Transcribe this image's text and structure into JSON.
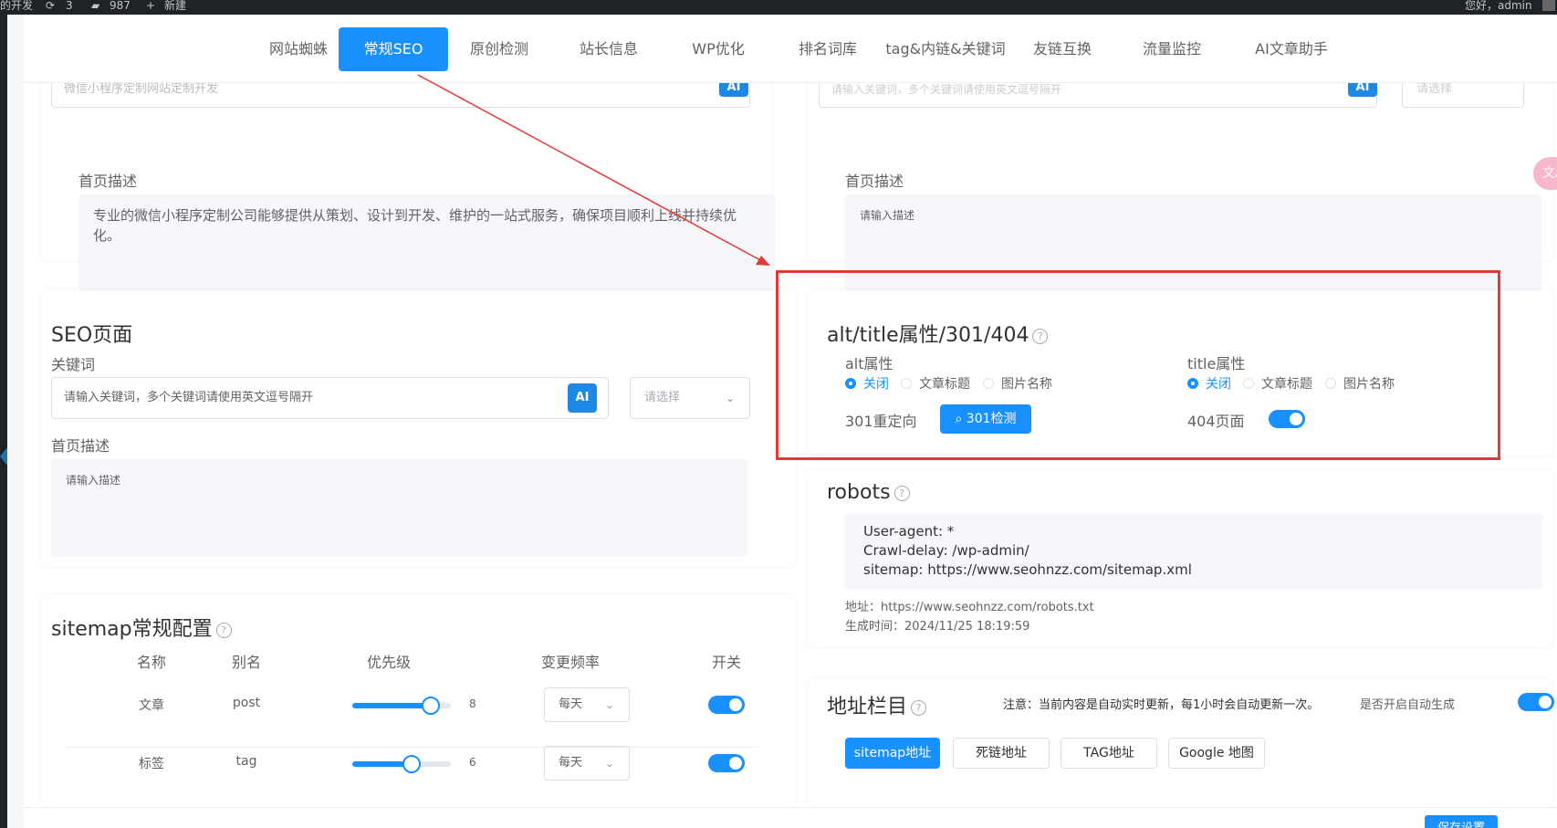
{
  "adminbar": {
    "left_text": "的开发",
    "comments": "3",
    "updates": "987",
    "new": "新建",
    "greeting": "您好，admin"
  },
  "tabs": [
    {
      "label": "网站蜘蛛"
    },
    {
      "label": "常规SEO"
    },
    {
      "label": "原创检测"
    },
    {
      "label": "站长信息"
    },
    {
      "label": "WP优化"
    },
    {
      "label": "排名词库"
    },
    {
      "label": "tag&内链&关键词"
    },
    {
      "label": "友链互换"
    },
    {
      "label": "流量监控"
    },
    {
      "label": "AI文章助手"
    }
  ],
  "top_left": {
    "keyword_value": "微信小程序定制网站定制开发",
    "desc_label": "首页描述",
    "desc_value": "专业的微信小程序定制公司能够提供从策划、设计到开发、维护的一站式服务，确保项目顺利上线并持续优化。",
    "ai_label": "AI"
  },
  "top_right": {
    "keyword_placeholder": "请输入关键词，多个关键词请使用英文逗号隔开",
    "select_placeholder": "请选择",
    "desc_label": "首页描述",
    "desc_placeholder": "请输入描述",
    "ai_label": "AI"
  },
  "seo_page": {
    "title": "SEO页面",
    "keyword_label": "关键词",
    "keyword_placeholder": "请输入关键词，多个关键词请使用英文逗号隔开",
    "ai_label": "AI",
    "select_placeholder": "请选择",
    "desc_label": "首页描述",
    "desc_placeholder": "请输入描述"
  },
  "alt_title": {
    "title": "alt/title属性/301/404",
    "alt_label": "alt属性",
    "title_label": "title属性",
    "options": [
      "关闭",
      "文章标题",
      "图片名称"
    ],
    "redirect_label": "301重定向",
    "check_button": "301检测",
    "page404_label": "404页面"
  },
  "robots": {
    "title": "robots",
    "lines": [
      "User-agent: *",
      "Crawl-delay: /wp-admin/",
      "sitemap: https://www.seohnzz.com/sitemap.xml"
    ],
    "address": "地址：https://www.seohnzz.com/robots.txt",
    "generated": "生成时间：2024/11/25 18:19:59"
  },
  "sitemap": {
    "title": "sitemap常规配置",
    "headers": [
      "名称",
      "别名",
      "优先级",
      "变更频率",
      "开关"
    ],
    "rows": [
      {
        "name": "文章",
        "alias": "post",
        "priority": 8,
        "freq": "每天"
      },
      {
        "name": "标签",
        "alias": "tag",
        "priority": 6,
        "freq": "每天"
      }
    ],
    "priority_max": 10
  },
  "address_section": {
    "title": "地址栏目",
    "notice": "注意：当前内容是自动实时更新，每1小时会自动更新一次。",
    "auto_label": "是否开启自动生成",
    "buttons": [
      "sitemap地址",
      "死链地址",
      "TAG地址",
      "Google 地图"
    ]
  },
  "save_button": "保存设置",
  "floating_icon": "translate-icon",
  "colors": {
    "primary": "#1890ff",
    "annotation": "#e53935"
  }
}
